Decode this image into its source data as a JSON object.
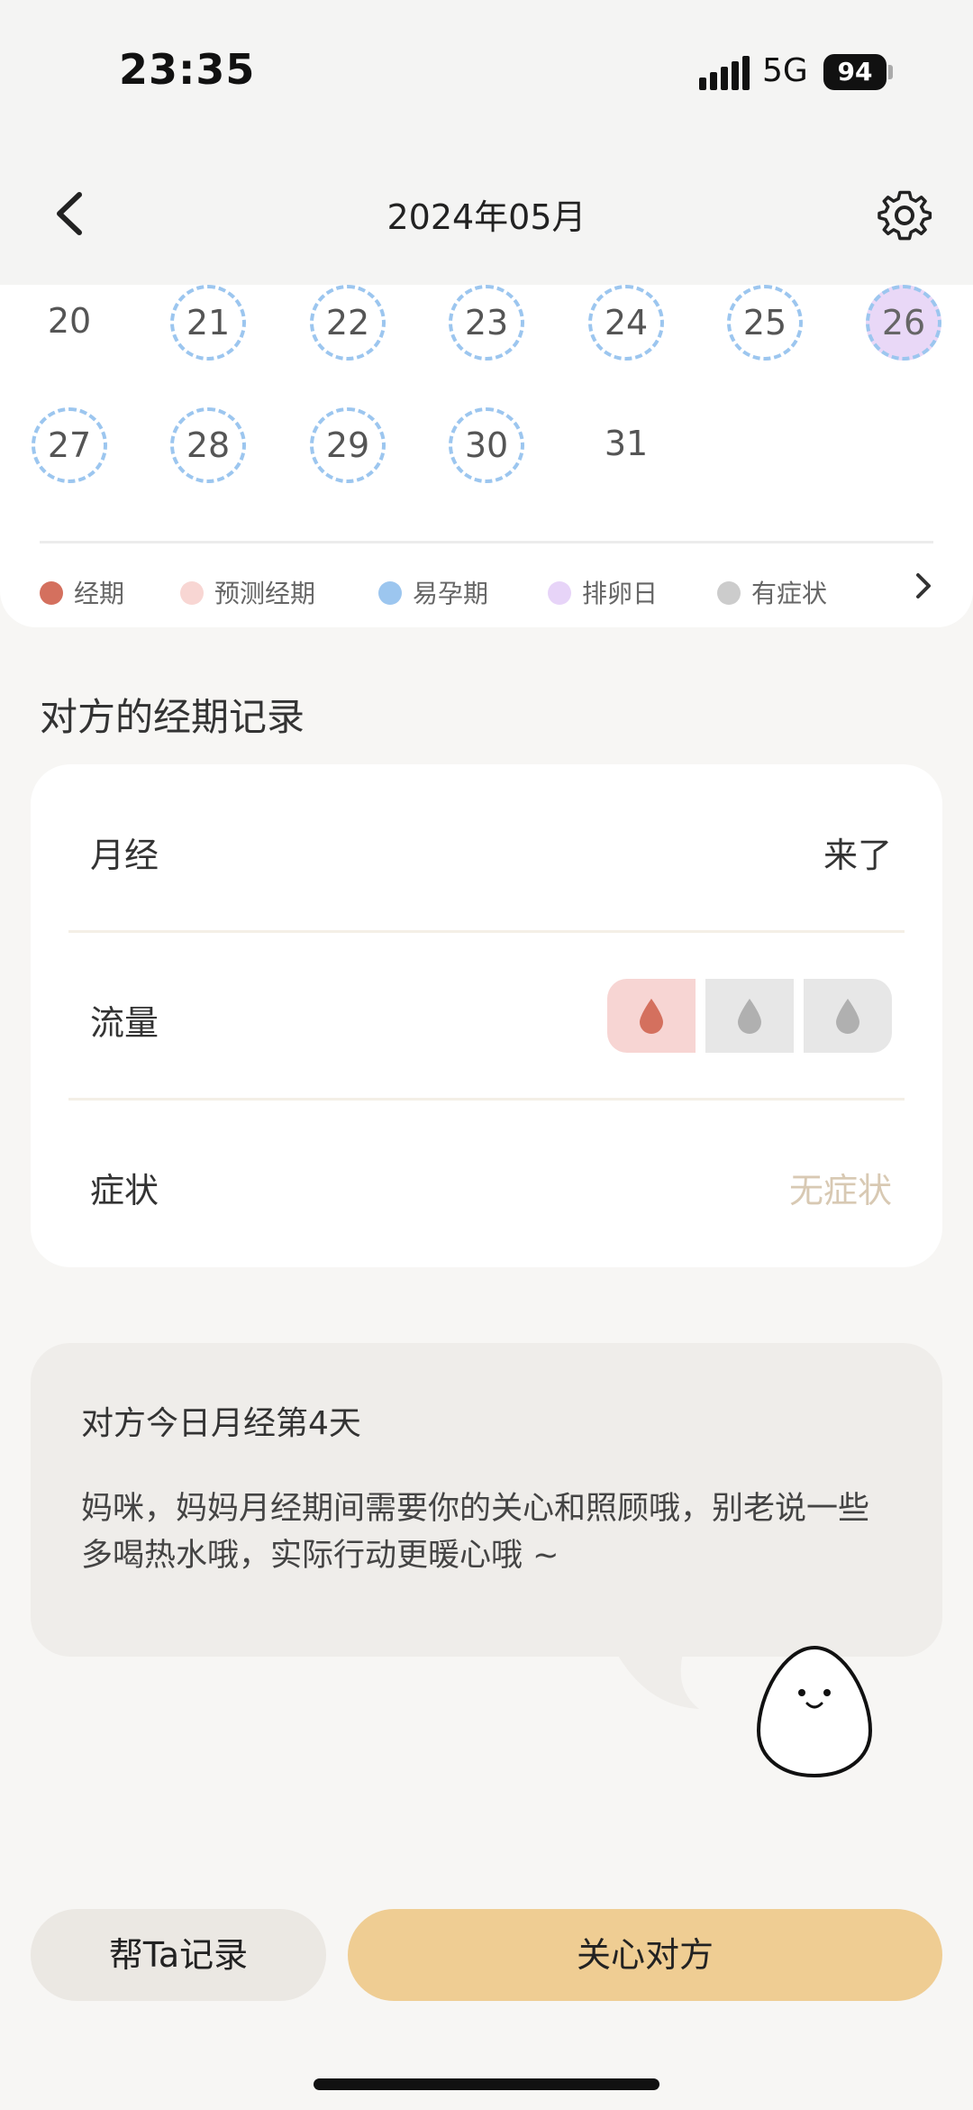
{
  "status_bar": {
    "time": "23:35",
    "network": "5G",
    "battery": "94"
  },
  "header": {
    "title": "2024年05月",
    "back_icon": "chevron-left-icon",
    "settings_icon": "gear-icon"
  },
  "calendar": {
    "row1": [
      {
        "day": "20",
        "state": "normal"
      },
      {
        "day": "21",
        "state": "fertile"
      },
      {
        "day": "22",
        "state": "fertile"
      },
      {
        "day": "23",
        "state": "fertile"
      },
      {
        "day": "24",
        "state": "fertile"
      },
      {
        "day": "25",
        "state": "fertile"
      },
      {
        "day": "26",
        "state": "ovulation"
      }
    ],
    "row2": [
      {
        "day": "27",
        "state": "fertile"
      },
      {
        "day": "28",
        "state": "fertile"
      },
      {
        "day": "29",
        "state": "fertile"
      },
      {
        "day": "30",
        "state": "fertile"
      },
      {
        "day": "31",
        "state": "normal"
      }
    ],
    "legend": [
      {
        "label": "经期",
        "color": "#d4705e"
      },
      {
        "label": "预测经期",
        "color": "#f8d6d3"
      },
      {
        "label": "易孕期",
        "color": "#9cc6ef"
      },
      {
        "label": "排卵日",
        "color": "#e7d4f8"
      },
      {
        "label": "有症状",
        "color": "#cccccc"
      }
    ]
  },
  "record": {
    "section_title": "对方的经期记录",
    "period_label": "月经",
    "period_value": "来了",
    "flow_label": "流量",
    "flow_level": 1,
    "flow_colors": {
      "active": "#d4705e",
      "inactive": "#b0b0b0"
    },
    "symptom_label": "症状",
    "symptom_value": "无症状"
  },
  "tip": {
    "title": "对方今日月经第4天",
    "body": "妈咪，妈妈月经期间需要你的关心和照顾哦，别老说一些多喝热水哦，实际行动更暖心哦 ~"
  },
  "buttons": {
    "record": "帮Ta记录",
    "care": "关心对方"
  }
}
